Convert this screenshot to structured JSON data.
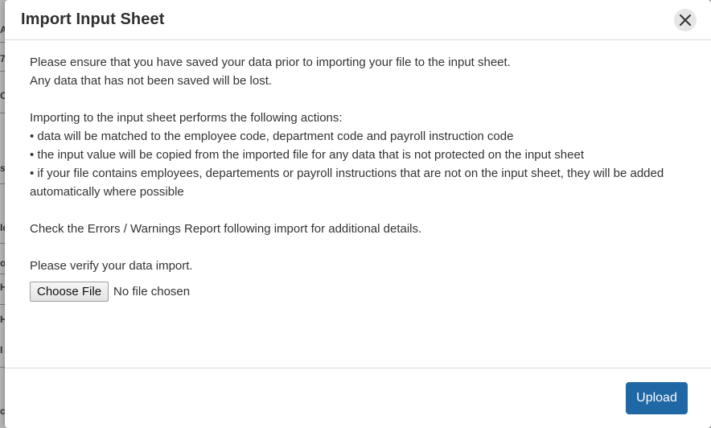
{
  "background_fragments": [
    "A",
    "7",
    "O",
    "s",
    "Id",
    "o",
    "H",
    "H",
    "I",
    "c"
  ],
  "modal": {
    "title": "Import Input Sheet",
    "close_icon": "close-icon",
    "body": {
      "intro_line1": "Please ensure that you have saved your data prior to importing your file to the input sheet.",
      "intro_line2": "Any data that has not been saved will be lost.",
      "actions_heading": "Importing to the input sheet performs the following actions:",
      "bullets": [
        "• data will be matched to the employee code, department code and payroll instruction code",
        "• the input value will be copied from the imported file for any data that is not protected on the input sheet",
        "• if your file contains employees, departements or payroll instructions that are not on the input sheet, they will be added automatically where possible"
      ],
      "report_note": "Check the Errors / Warnings Report following import for additional details.",
      "verify_note": "Please verify your data import."
    },
    "file_input": {
      "button_label": "Choose File",
      "status_text": "No file chosen"
    },
    "footer": {
      "upload_label": "Upload"
    }
  },
  "colors": {
    "primary_button": "#1f67a5",
    "title_text": "#2f2f2f",
    "body_text": "#333333"
  }
}
